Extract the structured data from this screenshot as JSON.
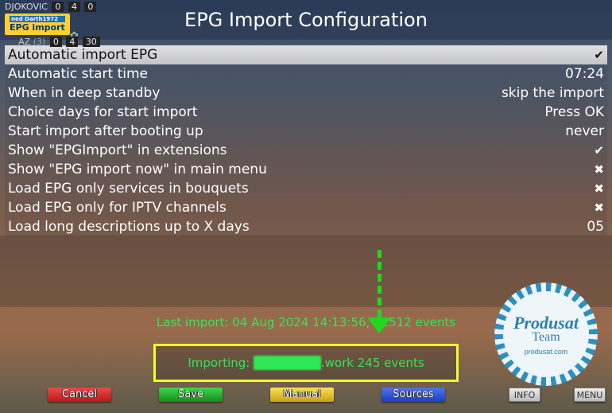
{
  "overlay": {
    "player1": "DJOKOVIC",
    "player2": "ALCARAZ",
    "seed": "(3)",
    "scores_top": [
      "0",
      "4",
      "0"
    ],
    "scores_bot": [
      "0",
      "4",
      "30"
    ],
    "pill_top": "ned Darth1972",
    "pill_main": "EPG import"
  },
  "title": "EPG Import Configuration",
  "rows": [
    {
      "label": "Automatic import EPG",
      "type": "check",
      "value": true,
      "selected": true
    },
    {
      "label": "Automatic start time",
      "type": "text",
      "value": "07:24"
    },
    {
      "label": "When in deep standby",
      "type": "text",
      "value": "skip the import"
    },
    {
      "label": "Choice days for start import",
      "type": "text",
      "value": "Press OK"
    },
    {
      "label": "Start import after booting up",
      "type": "text",
      "value": "never"
    },
    {
      "label": "Show \"EPGImport\" in extensions",
      "type": "check",
      "value": true
    },
    {
      "label": "Show \"EPG import now\" in main menu",
      "type": "check",
      "value": false
    },
    {
      "label": "Load EPG only services in bouquets",
      "type": "check",
      "value": false
    },
    {
      "label": "Load EPG only for IPTV channels",
      "type": "check",
      "value": false
    },
    {
      "label": "Load long descriptions up to X days",
      "type": "text",
      "value": "05"
    }
  ],
  "status": {
    "last_prefix": "Last import: ",
    "last_value": "04 Aug 2024 14:13:56, 11512 events",
    "importing_prefix": "Importing: ",
    "importing_blur": "███████",
    "importing_suffix": ".work 245 events"
  },
  "buttons": {
    "red": "Cancel",
    "green": "Save",
    "yellow": "Manual",
    "blue": "Sources",
    "info": "INFO",
    "menu": "MENU"
  },
  "badge": {
    "brand": "Produsat",
    "sub": "Team",
    "url": "produsat.com"
  }
}
